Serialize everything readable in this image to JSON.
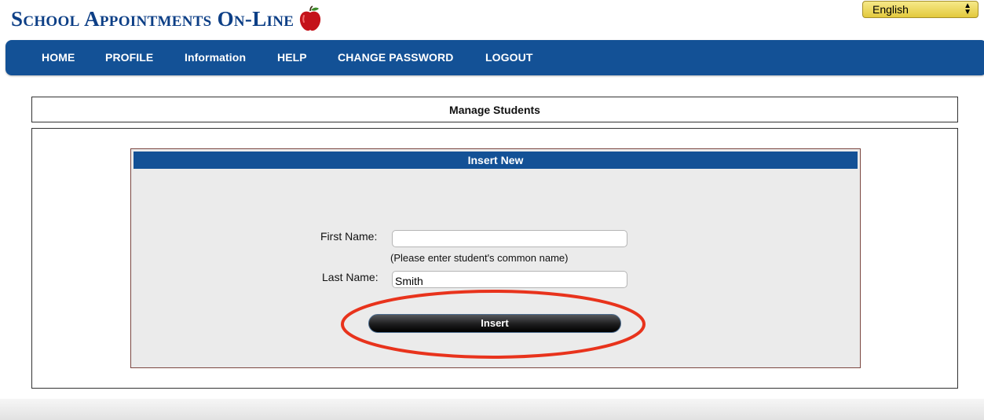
{
  "header": {
    "logo_text": "School Appointments On-Line",
    "logo_icon": "apple-icon",
    "language_selected": "English",
    "brand_color": "#135196"
  },
  "nav": {
    "items": [
      {
        "label": "HOME"
      },
      {
        "label": "PROFILE"
      },
      {
        "label": "Information"
      },
      {
        "label": "HELP"
      },
      {
        "label": "CHANGE PASSWORD"
      },
      {
        "label": "LOGOUT"
      }
    ]
  },
  "page": {
    "title": "Manage Students"
  },
  "form": {
    "header": "Insert New",
    "first_name_label": "First Name:",
    "first_name_value": "",
    "first_name_hint": "(Please enter student's common name)",
    "last_name_label": "Last Name:",
    "last_name_value": "Smith",
    "insert_label": "Insert",
    "highlight_color": "#e8331c"
  }
}
